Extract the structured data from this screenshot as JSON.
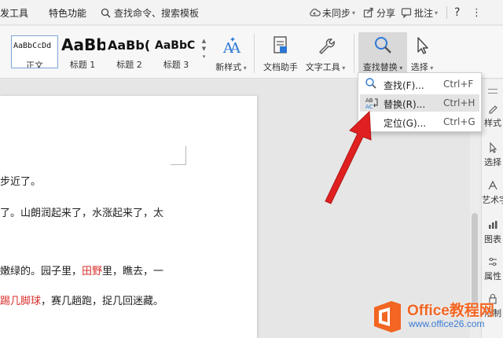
{
  "tabbar": {
    "dev_tools": "发工具",
    "special": "特色功能",
    "search_placeholder": "查找命令、搜索模板",
    "sync": "未同步",
    "share": "分享",
    "annotate": "批注",
    "help": "?"
  },
  "ribbon": {
    "styles": [
      {
        "sample": "AaBbCcDd",
        "label": "正文"
      },
      {
        "sample": "AaBb",
        "label": "标题 1"
      },
      {
        "sample": "AaBb(",
        "label": "标题 2"
      },
      {
        "sample": "AaBbC",
        "label": "标题 3"
      }
    ],
    "new_style": "新样式",
    "doc_helper": "文档助手",
    "text_tools": "文字工具",
    "find_replace": "查找替换",
    "select": "选择"
  },
  "menu": {
    "items": [
      {
        "label": "查找(F)...",
        "shortcut": "Ctrl+F"
      },
      {
        "label": "替换(R)...",
        "shortcut": "Ctrl+H"
      },
      {
        "label": "定位(G)...",
        "shortcut": "Ctrl+G"
      }
    ]
  },
  "right_panel": [
    "样式",
    "选择",
    "艺术字",
    "图表",
    "属性",
    "限制"
  ],
  "document": {
    "line1": "步近了。",
    "line2": "了。山朗润起来了，水涨起来了，太",
    "line3": "嫩绿的。园子里，",
    "line3_red": "田野",
    "line3_end": "里，瞧去，一",
    "line4_red": "踢几脚球",
    "line4_end": "，赛几趟跑，捉几回迷藏。"
  },
  "watermark": {
    "brand": "Office教程网",
    "url": "www.office26.com"
  },
  "colors": {
    "accent_blue": "#2b78d6",
    "red_text": "#d9302c",
    "arrow_red": "#e02020",
    "watermark_orange": "#f26522"
  }
}
